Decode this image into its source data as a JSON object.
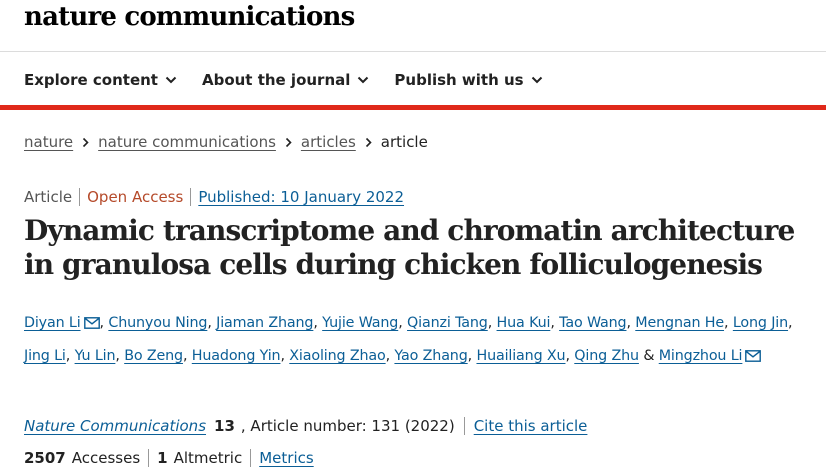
{
  "site": {
    "brand": "nature communications"
  },
  "nav": {
    "items": [
      {
        "label": "Explore content",
        "icon": "chevron-down-icon"
      },
      {
        "label": "About the journal",
        "icon": "chevron-down-icon"
      },
      {
        "label": "Publish with us",
        "icon": "chevron-down-icon"
      }
    ]
  },
  "breadcrumb": {
    "items": [
      "nature",
      "nature communications",
      "articles"
    ],
    "current": "article",
    "separator_icon": "chevron-right-icon"
  },
  "article": {
    "type": "Article",
    "access": "Open Access",
    "published": "Published: 10 January 2022",
    "title": "Dynamic transcriptome and chromatin architecture in granulosa cells during chicken folliculogenesis",
    "authors": [
      {
        "name": "Diyan Li",
        "email_icon": true
      },
      {
        "name": "Chunyou Ning"
      },
      {
        "name": "Jiaman Zhang"
      },
      {
        "name": "Yujie Wang"
      },
      {
        "name": "Qianzi Tang"
      },
      {
        "name": "Hua Kui"
      },
      {
        "name": "Tao Wang"
      },
      {
        "name": "Mengnan He"
      },
      {
        "name": "Long Jin"
      },
      {
        "name": "Jing Li"
      },
      {
        "name": "Yu Lin"
      },
      {
        "name": "Bo Zeng"
      },
      {
        "name": "Huadong Yin"
      },
      {
        "name": "Xiaoling Zhao"
      },
      {
        "name": "Yao Zhang"
      },
      {
        "name": "Huailiang Xu"
      },
      {
        "name": "Qing Zhu"
      },
      {
        "name": "Mingzhou Li",
        "email_icon": true
      }
    ],
    "author_separator": ",",
    "author_conjunction": "&"
  },
  "citation": {
    "journal": "Nature Communications",
    "volume": "13",
    "article_number": ", Article number: 131 (2022)",
    "cite_label": "Cite this article"
  },
  "metrics": {
    "accesses_count": "2507",
    "accesses_label": "Accesses",
    "altmetric_count": "1",
    "altmetric_label": "Altmetric",
    "metrics_link": "Metrics"
  },
  "colors": {
    "accent_red": "#e0291a",
    "link_blue": "#0b5e96",
    "open_access": "#b54a2a"
  }
}
